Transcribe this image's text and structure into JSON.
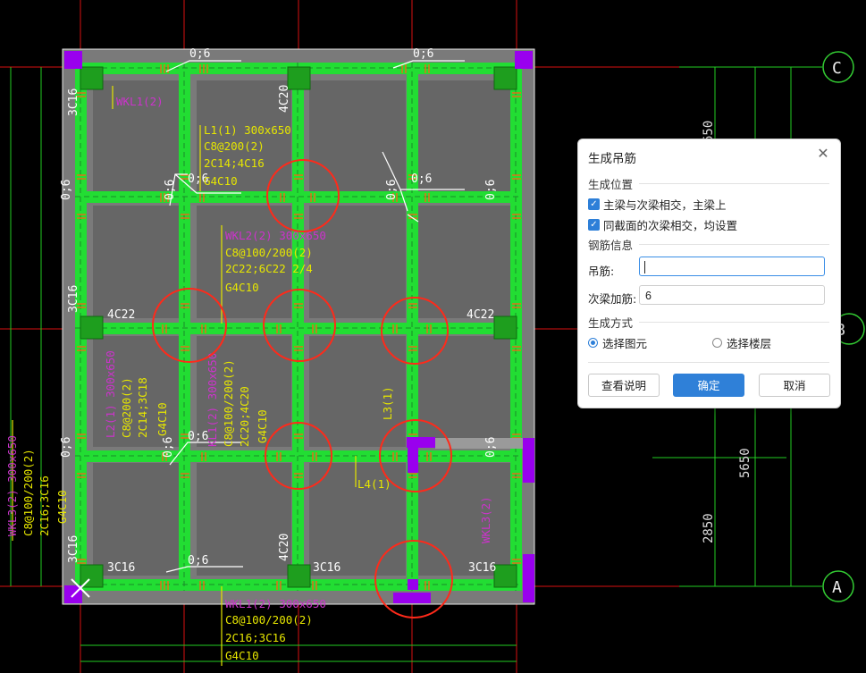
{
  "drawing": {
    "axis_labels": {
      "top": "C",
      "mid": "B",
      "bottom": "A"
    },
    "dims": {
      "d1": "650",
      "d2": "5650",
      "d3": "2850"
    },
    "marks": {
      "m06": "0;6",
      "c4c20": "4C20",
      "c3c16": "3C16",
      "c4c22": "4C22"
    },
    "texts": {
      "wkl1_top": "WKL1(2)",
      "l1_block": [
        "L1(1) 300x650",
        "C8@200(2)",
        "2C14;4C16",
        "G4C10"
      ],
      "wkl2_block": [
        "WKL2(2) 300x650",
        "C8@100/200(2)",
        "2C22;6C22 2/4",
        "G4C10"
      ],
      "l2_block": [
        "L2(1) 300x650",
        "C8@200(2)",
        "2C14;3C18",
        "G4C10"
      ],
      "kl1_block": [
        "KL1(2) 300x650",
        "C8@100/200(2)",
        "2C20;4C20",
        "G4C10"
      ],
      "wkl3_block": [
        "WKL3(2) 300x650",
        "C8@100/200(2)",
        "2C16;3C16",
        "G4C10"
      ],
      "wkl1_bottom": [
        "WKL1(2) 300x650",
        "C8@100/200(2)",
        "2C16;3C16",
        "G4C10"
      ],
      "l3": "L3(1)",
      "l4": "L4(1)",
      "wkl_right": "WKL3(2)"
    },
    "colors": {
      "beam": "#22dd33",
      "slab": "#6b6b6b",
      "column": "#1e9e1e",
      "magenta": "#cc33cc",
      "yellow": "#e6e600",
      "circle": "#ff2a1a",
      "axis": "#33cc33",
      "purple": "#9900ee"
    }
  },
  "dialog": {
    "title": "生成吊筋",
    "close_icon": "close-icon",
    "sections": {
      "position": "生成位置",
      "rebar": "钢筋信息",
      "method": "生成方式"
    },
    "checkboxes": [
      {
        "label": "主梁与次梁相交，主梁上",
        "checked": true
      },
      {
        "label": "同截面的次梁相交，均设置",
        "checked": true
      }
    ],
    "fields": {
      "hanger_label": "吊筋:",
      "hanger_value": "",
      "extra_label": "次梁加筋:",
      "extra_value": "6"
    },
    "radios": [
      {
        "label": "选择图元",
        "selected": true
      },
      {
        "label": "选择楼层",
        "selected": false
      }
    ],
    "buttons": {
      "help": "查看说明",
      "ok": "确定",
      "cancel": "取消"
    }
  }
}
